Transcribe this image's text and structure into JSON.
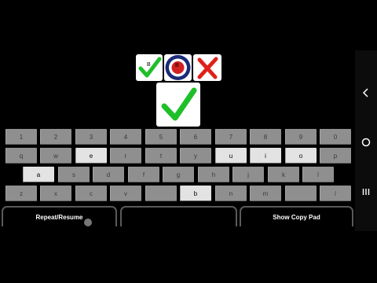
{
  "tiles": {
    "target_label": "B",
    "small_bullseye_label": "B"
  },
  "keyboard": {
    "rows": [
      [
        {
          "label": "1",
          "lit": false
        },
        {
          "label": "2",
          "lit": false
        },
        {
          "label": "3",
          "lit": false
        },
        {
          "label": "4",
          "lit": false
        },
        {
          "label": "5",
          "lit": false
        },
        {
          "label": "6",
          "lit": false
        },
        {
          "label": "7",
          "lit": false
        },
        {
          "label": "8",
          "lit": false
        },
        {
          "label": "9",
          "lit": false
        },
        {
          "label": "0",
          "lit": false
        }
      ],
      [
        {
          "label": "q",
          "lit": false
        },
        {
          "label": "w",
          "lit": false
        },
        {
          "label": "e",
          "lit": true
        },
        {
          "label": "r",
          "lit": false
        },
        {
          "label": "t",
          "lit": false
        },
        {
          "label": "y",
          "lit": false
        },
        {
          "label": "u",
          "lit": true
        },
        {
          "label": "i",
          "lit": true
        },
        {
          "label": "o",
          "lit": true
        },
        {
          "label": "p",
          "lit": false
        }
      ],
      [
        {
          "label": "a",
          "lit": true
        },
        {
          "label": "s",
          "lit": false
        },
        {
          "label": "d",
          "lit": false
        },
        {
          "label": "f",
          "lit": false
        },
        {
          "label": "g",
          "lit": false
        },
        {
          "label": "h",
          "lit": false
        },
        {
          "label": "j",
          "lit": false
        },
        {
          "label": "k",
          "lit": false
        },
        {
          "label": "l",
          "lit": false
        }
      ],
      [
        {
          "label": "z",
          "lit": false
        },
        {
          "label": "x",
          "lit": false
        },
        {
          "label": "c",
          "lit": false
        },
        {
          "label": "v",
          "lit": false
        },
        {
          "label": "b",
          "lit": true
        },
        {
          "label": "n",
          "lit": false
        },
        {
          "label": "m",
          "lit": false
        },
        {
          "label": "",
          "lit": false
        },
        {
          "label": "/",
          "lit": false
        }
      ]
    ]
  },
  "pads": {
    "left_label": "Repeat/Resume",
    "middle_label": "",
    "right_label": "Show Copy Pad"
  },
  "colors": {
    "check": "#1fbf2a",
    "cross": "#e0201a",
    "bullseye_blue": "#1b2a78",
    "bullseye_red": "#d42020",
    "key": "#8f8f8f",
    "key_lit": "#e3e3e3"
  },
  "icons": {
    "nav_back": "chevron-left-icon",
    "nav_home": "circle-icon",
    "nav_recent": "three-bars-icon"
  }
}
